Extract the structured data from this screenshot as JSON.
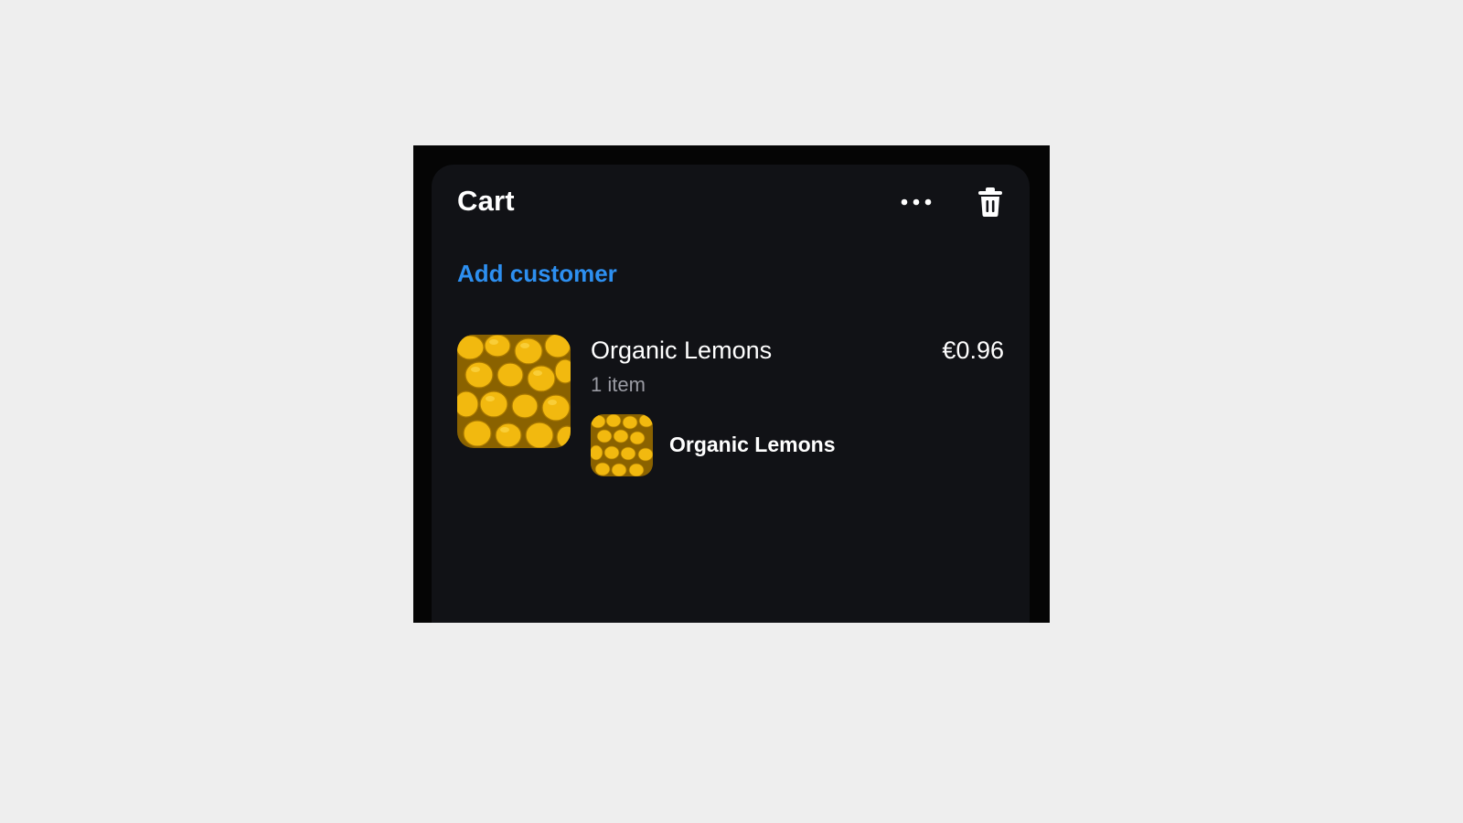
{
  "cart": {
    "title": "Cart",
    "add_customer_label": "Add customer",
    "more_icon": "more-horizontal-icon",
    "trash_icon": "trash-icon",
    "accent_color": "#2d8ff0",
    "items": [
      {
        "name": "Organic Lemons",
        "price": "€0.96",
        "count": "1 item",
        "image": "lemons-image",
        "variants": [
          {
            "name": "Organic Lemons",
            "image": "lemons-image"
          }
        ]
      }
    ]
  }
}
